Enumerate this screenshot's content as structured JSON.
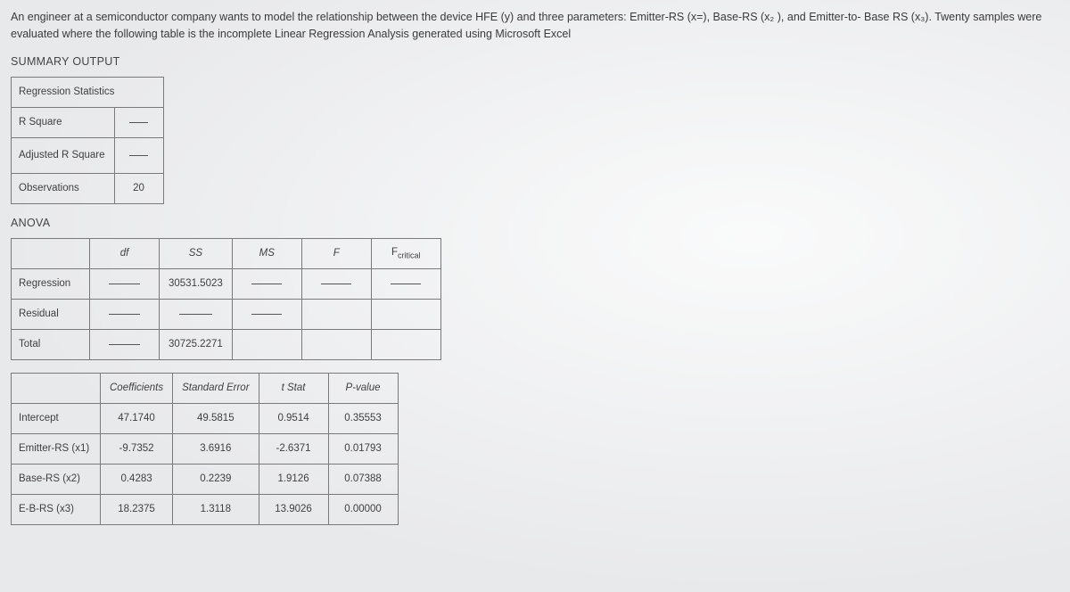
{
  "problem": "An engineer at a semiconductor company wants to model the relationship between the device HFE (y) and three parameters: Emitter-RS (x=), Base-RS (x₂ ), and Emitter-to- Base RS (x₃). Twenty samples were evaluated where the following table is the incomplete Linear Regression Analysis generated using Microsoft Excel",
  "summary_title": "SUMMARY OUTPUT",
  "stats": {
    "header": "Regression Statistics",
    "rows": [
      {
        "label": "R Square",
        "value": ""
      },
      {
        "label": "Adjusted R Square",
        "value": ""
      },
      {
        "label": "Observations",
        "value": "20"
      }
    ]
  },
  "anova_title": "ANOVA",
  "anova": {
    "headers": [
      "",
      "df",
      "SS",
      "MS",
      "F",
      "Fcritical"
    ],
    "rows": [
      {
        "label": "Regression",
        "df": "",
        "ss": "30531.5023",
        "ms": "",
        "f": "",
        "fc": ""
      },
      {
        "label": "Residual",
        "df": "",
        "ss": "",
        "ms": "",
        "f": null,
        "fc": null
      },
      {
        "label": "Total",
        "df": "",
        "ss": "30725.2271",
        "ms": null,
        "f": null,
        "fc": null
      }
    ]
  },
  "coef": {
    "headers": [
      "",
      "Coefficients",
      "Standard Error",
      "t Stat",
      "P-value"
    ],
    "rows": [
      {
        "label": "Intercept",
        "c": "47.1740",
        "se": "49.5815",
        "t": "0.9514",
        "p": "0.35553"
      },
      {
        "label": "Emitter-RS (x1)",
        "c": "-9.7352",
        "se": "3.6916",
        "t": "-2.6371",
        "p": "0.01793"
      },
      {
        "label": "Base-RS (x2)",
        "c": "0.4283",
        "se": "0.2239",
        "t": "1.9126",
        "p": "0.07388"
      },
      {
        "label": "E-B-RS (x3)",
        "c": "18.2375",
        "se": "1.3118",
        "t": "13.9026",
        "p": "0.00000"
      }
    ]
  }
}
